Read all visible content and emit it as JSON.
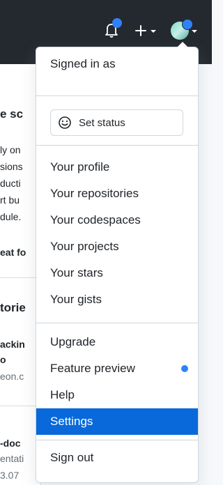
{
  "menu": {
    "signed_in_label": "Signed in as",
    "set_status_label": "Set status",
    "items_group1": [
      {
        "label": "Your profile"
      },
      {
        "label": "Your repositories"
      },
      {
        "label": "Your codespaces"
      },
      {
        "label": "Your projects"
      },
      {
        "label": "Your stars"
      },
      {
        "label": "Your gists"
      }
    ],
    "items_group2": [
      {
        "label": "Upgrade"
      },
      {
        "label": "Feature preview"
      },
      {
        "label": "Help"
      },
      {
        "label": "Settings"
      }
    ],
    "sign_out_label": "Sign out",
    "active_item": "Settings"
  },
  "background_text": {
    "heading": "e sc",
    "lines": [
      "ly on",
      "sions",
      "ducti",
      "rt bu",
      "dule."
    ],
    "link": "eat fo",
    "section": "torie",
    "repo1_a": "ackin",
    "repo1_b": "o",
    "repo1_c": "eon.c",
    "repo2_a": "-doc",
    "repo2_b": "entati",
    "repo2_c": "3.07"
  },
  "colors": {
    "header_bg": "#24292f",
    "accent": "#0969da",
    "notification_dot": "#2f81f7"
  },
  "icons": {
    "bell": "bell-icon",
    "plus": "plus-icon",
    "avatar": "avatar",
    "smile": "smiley-icon",
    "caret": "caret-down-icon"
  }
}
